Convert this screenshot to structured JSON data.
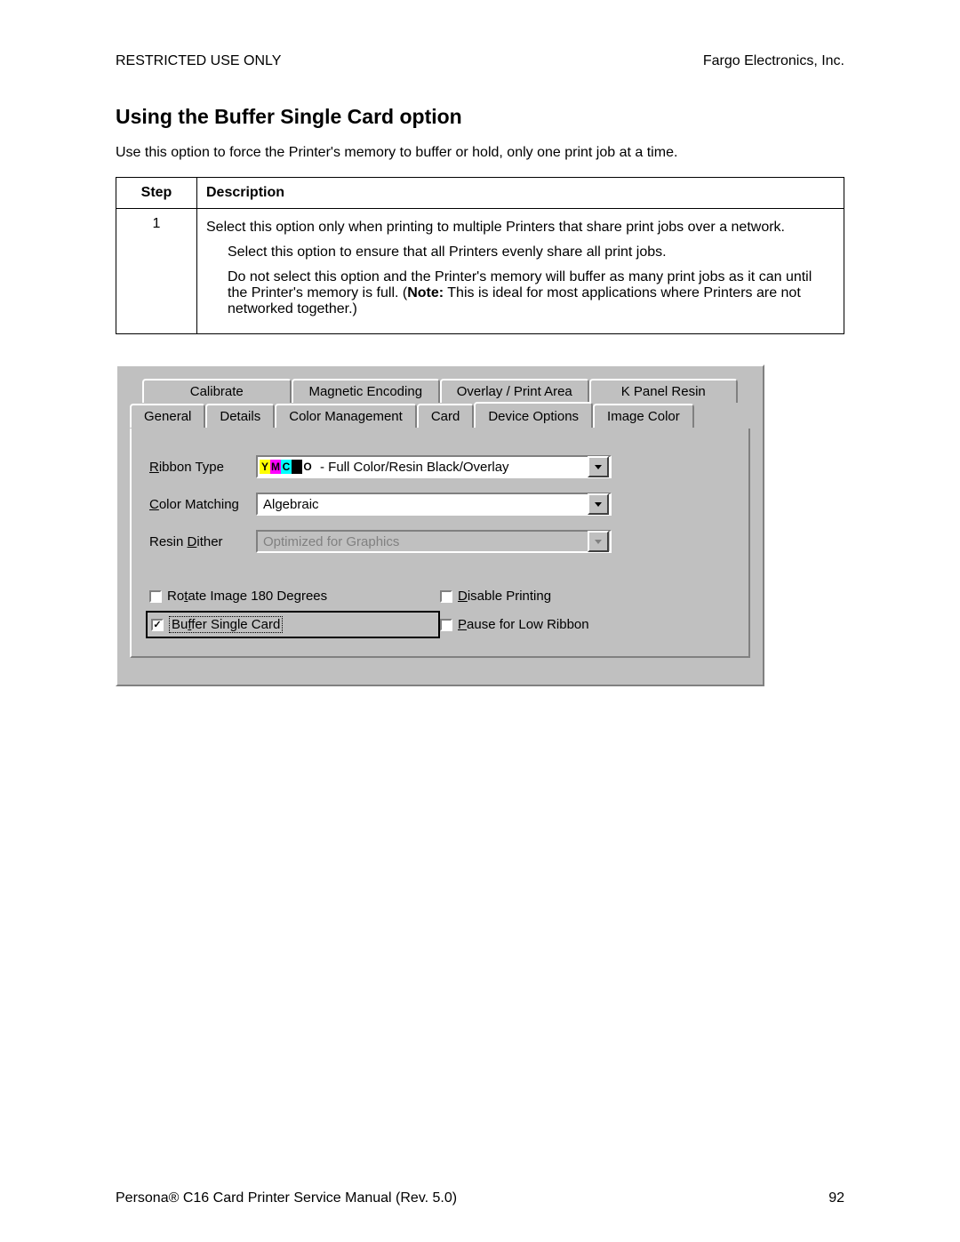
{
  "header": {
    "left": "RESTRICTED USE ONLY",
    "right": "Fargo Electronics, Inc."
  },
  "section_title": "Using the Buffer Single Card option",
  "intro": "Use this option to force the Printer's memory to buffer or hold, only one print job at a time.",
  "table": {
    "step_header": "Step",
    "desc_header": "Description",
    "step_num": "1",
    "p1": "Select this option only when printing to multiple Printers that share print jobs over a network.",
    "p2": "Select this option to ensure that all Printers evenly share all print jobs.",
    "p3a": "Do not select this option and the Printer's memory will buffer as many print jobs as it can until the Printer's memory is full. (",
    "p3_note_label": "Note:",
    "p3b": "  This is ideal for most applications where Printers are not networked together.)"
  },
  "tabs_back": [
    "Calibrate",
    "Magnetic Encoding",
    "Overlay / Print Area",
    "K Panel Resin"
  ],
  "tabs_front": [
    "General",
    "Details",
    "Color Management",
    "Card",
    "Device Options",
    "Image Color"
  ],
  "active_tab_index": 4,
  "form": {
    "ribbon_label_pre": "R",
    "ribbon_label_post": "ibbon Type",
    "ribbon_value_suffix": " - Full Color/Resin Black/Overlay",
    "color_label_pre": "C",
    "color_label_post": "olor Matching",
    "color_value": "Algebraic",
    "dither_label_pre": "Resin ",
    "dither_label_u": "D",
    "dither_label_post": "ither",
    "dither_value": "Optimized for Graphics",
    "chk_rotate_pre": "Ro",
    "chk_rotate_u": "t",
    "chk_rotate_post": "ate Image 180 Degrees",
    "chk_disable_u": "D",
    "chk_disable_post": "isable Printing",
    "chk_buffer_pre": "Bu",
    "chk_buffer_u": "f",
    "chk_buffer_post": "fer Single Card",
    "chk_pause_u": "P",
    "chk_pause_post": "ause for Low Ribbon"
  },
  "footer": {
    "left_pre": "Persona",
    "left_reg": "®",
    "left_post": " C16 Card Printer Service Manual (Rev. 5.0)",
    "right": "92"
  },
  "ymcko_letters": {
    "y": "Y",
    "m": "M",
    "c": "C",
    "k": "K",
    "o": "O"
  }
}
